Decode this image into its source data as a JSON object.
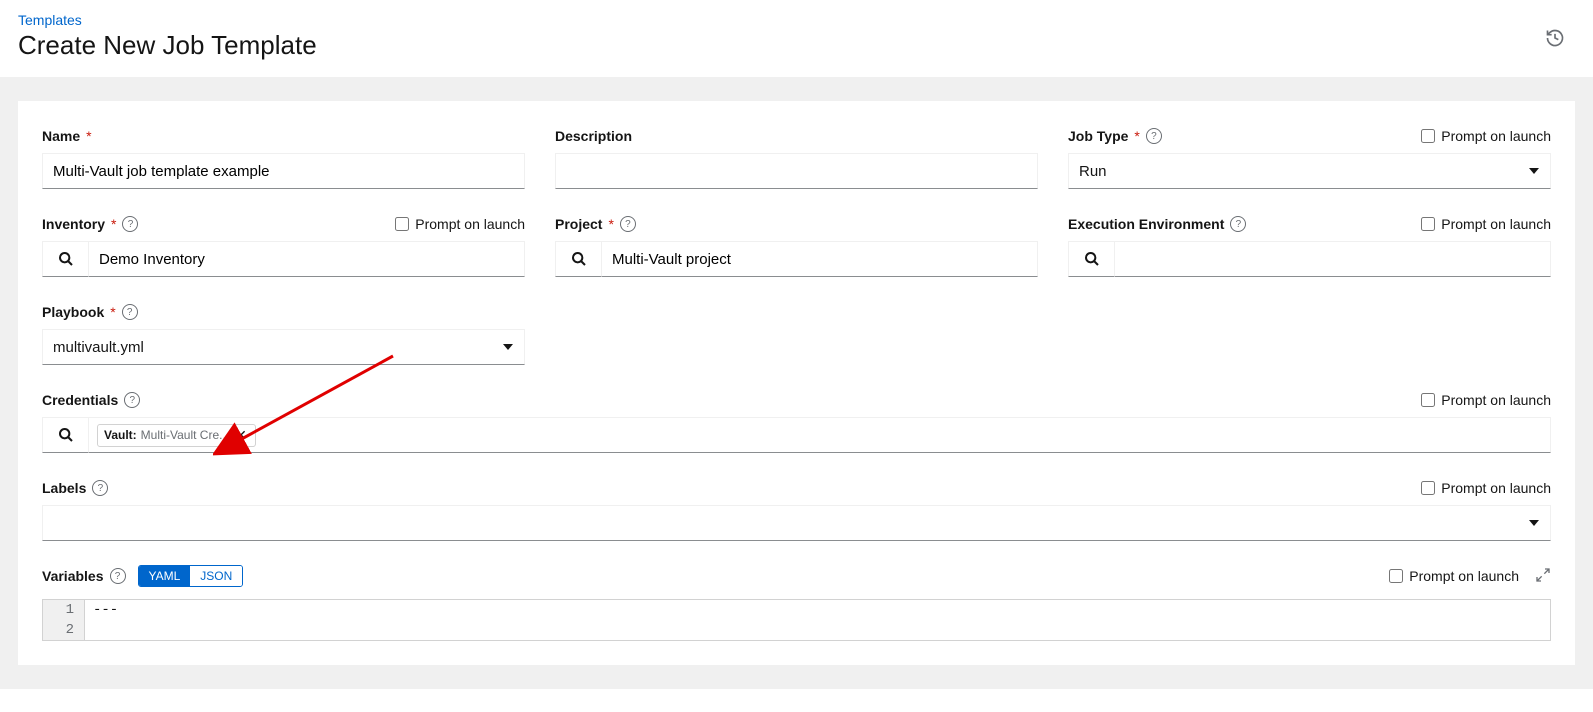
{
  "breadcrumb": "Templates",
  "page_title": "Create New Job Template",
  "prompt_label": "Prompt on launch",
  "labels": {
    "name": "Name",
    "description": "Description",
    "job_type": "Job Type",
    "inventory": "Inventory",
    "project": "Project",
    "exec_env": "Execution Environment",
    "playbook": "Playbook",
    "credentials": "Credentials",
    "labels_field": "Labels",
    "variables": "Variables"
  },
  "values": {
    "name": "Multi-Vault job template example",
    "description": "",
    "job_type": "Run",
    "inventory": "Demo Inventory",
    "project": "Multi-Vault project",
    "exec_env": "",
    "playbook": "multivault.yml",
    "labels_field": ""
  },
  "credentials_chip": {
    "type": "Vault:",
    "name": "Multi-Vault Cre..."
  },
  "toggle": {
    "yaml": "YAML",
    "json": "JSON"
  },
  "editor": {
    "lines": [
      {
        "num": "1",
        "text": "---"
      },
      {
        "num": "2",
        "text": ""
      }
    ]
  }
}
